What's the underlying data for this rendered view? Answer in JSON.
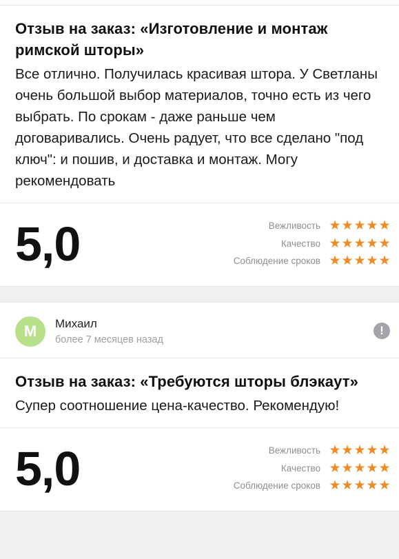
{
  "reviews": [
    {
      "title": "Отзыв на заказ: «Изготовление и монтаж римской шторы»",
      "text": "Все отлично. Получилась красивая штора. У Светланы очень большой выбор материалов, точно есть из чего выбрать. По срокам - даже раньше чем договаривались. Очень радует, что все сделано \"под ключ\": и пошив, и доставка и монтаж. Могу рекомендовать",
      "score": "5,0",
      "criteria": [
        {
          "label": "Вежливость",
          "stars": 5
        },
        {
          "label": "Качество",
          "stars": 5
        },
        {
          "label": "Соблюдение сроков",
          "stars": 5
        }
      ]
    },
    {
      "author": {
        "initial": "М",
        "name": "Михаил",
        "time": "более 7 месяцев назад",
        "avatar_color": "#b8e08a"
      },
      "title": "Отзыв на заказ: «Требуются шторы блэкаут»",
      "text": "Супер соотношение цена-качество. Рекомендую!",
      "score": "5,0",
      "criteria": [
        {
          "label": "Вежливость",
          "stars": 5
        },
        {
          "label": "Качество",
          "stars": 5
        },
        {
          "label": "Соблюдение сроков",
          "stars": 5
        }
      ]
    }
  ],
  "icons": {
    "star": "star-icon",
    "report": "exclamation-icon"
  },
  "colors": {
    "star": "#f08a24",
    "avatar": "#b8e08a"
  }
}
